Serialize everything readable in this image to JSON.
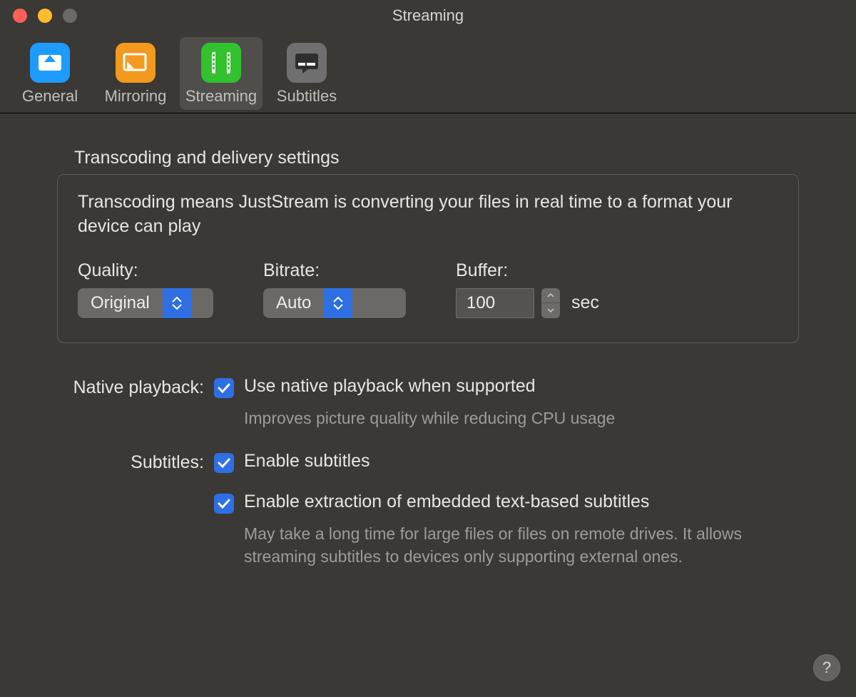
{
  "window": {
    "title": "Streaming"
  },
  "toolbar": {
    "items": [
      {
        "label": "General"
      },
      {
        "label": "Mirroring"
      },
      {
        "label": "Streaming"
      },
      {
        "label": "Subtitles"
      }
    ]
  },
  "transcoding": {
    "section_title": "Transcoding and delivery settings",
    "description": "Transcoding means JustStream is converting your files in real time to a format your device can play",
    "quality_label": "Quality:",
    "quality_value": "Original",
    "bitrate_label": "Bitrate:",
    "bitrate_value": "Auto",
    "buffer_label": "Buffer:",
    "buffer_value": "100",
    "buffer_unit": "sec"
  },
  "native": {
    "row_label": "Native playback:",
    "check_label": "Use native playback when supported",
    "help": "Improves picture quality while reducing CPU usage"
  },
  "subtitles": {
    "row_label": "Subtitles:",
    "check1_label": "Enable subtitles",
    "check2_label": "Enable extraction of embedded text-based subtitles",
    "check2_help": "May take a long time for large files or files on remote drives. It allows streaming subtitles to devices only supporting external ones."
  },
  "help_button": "?"
}
